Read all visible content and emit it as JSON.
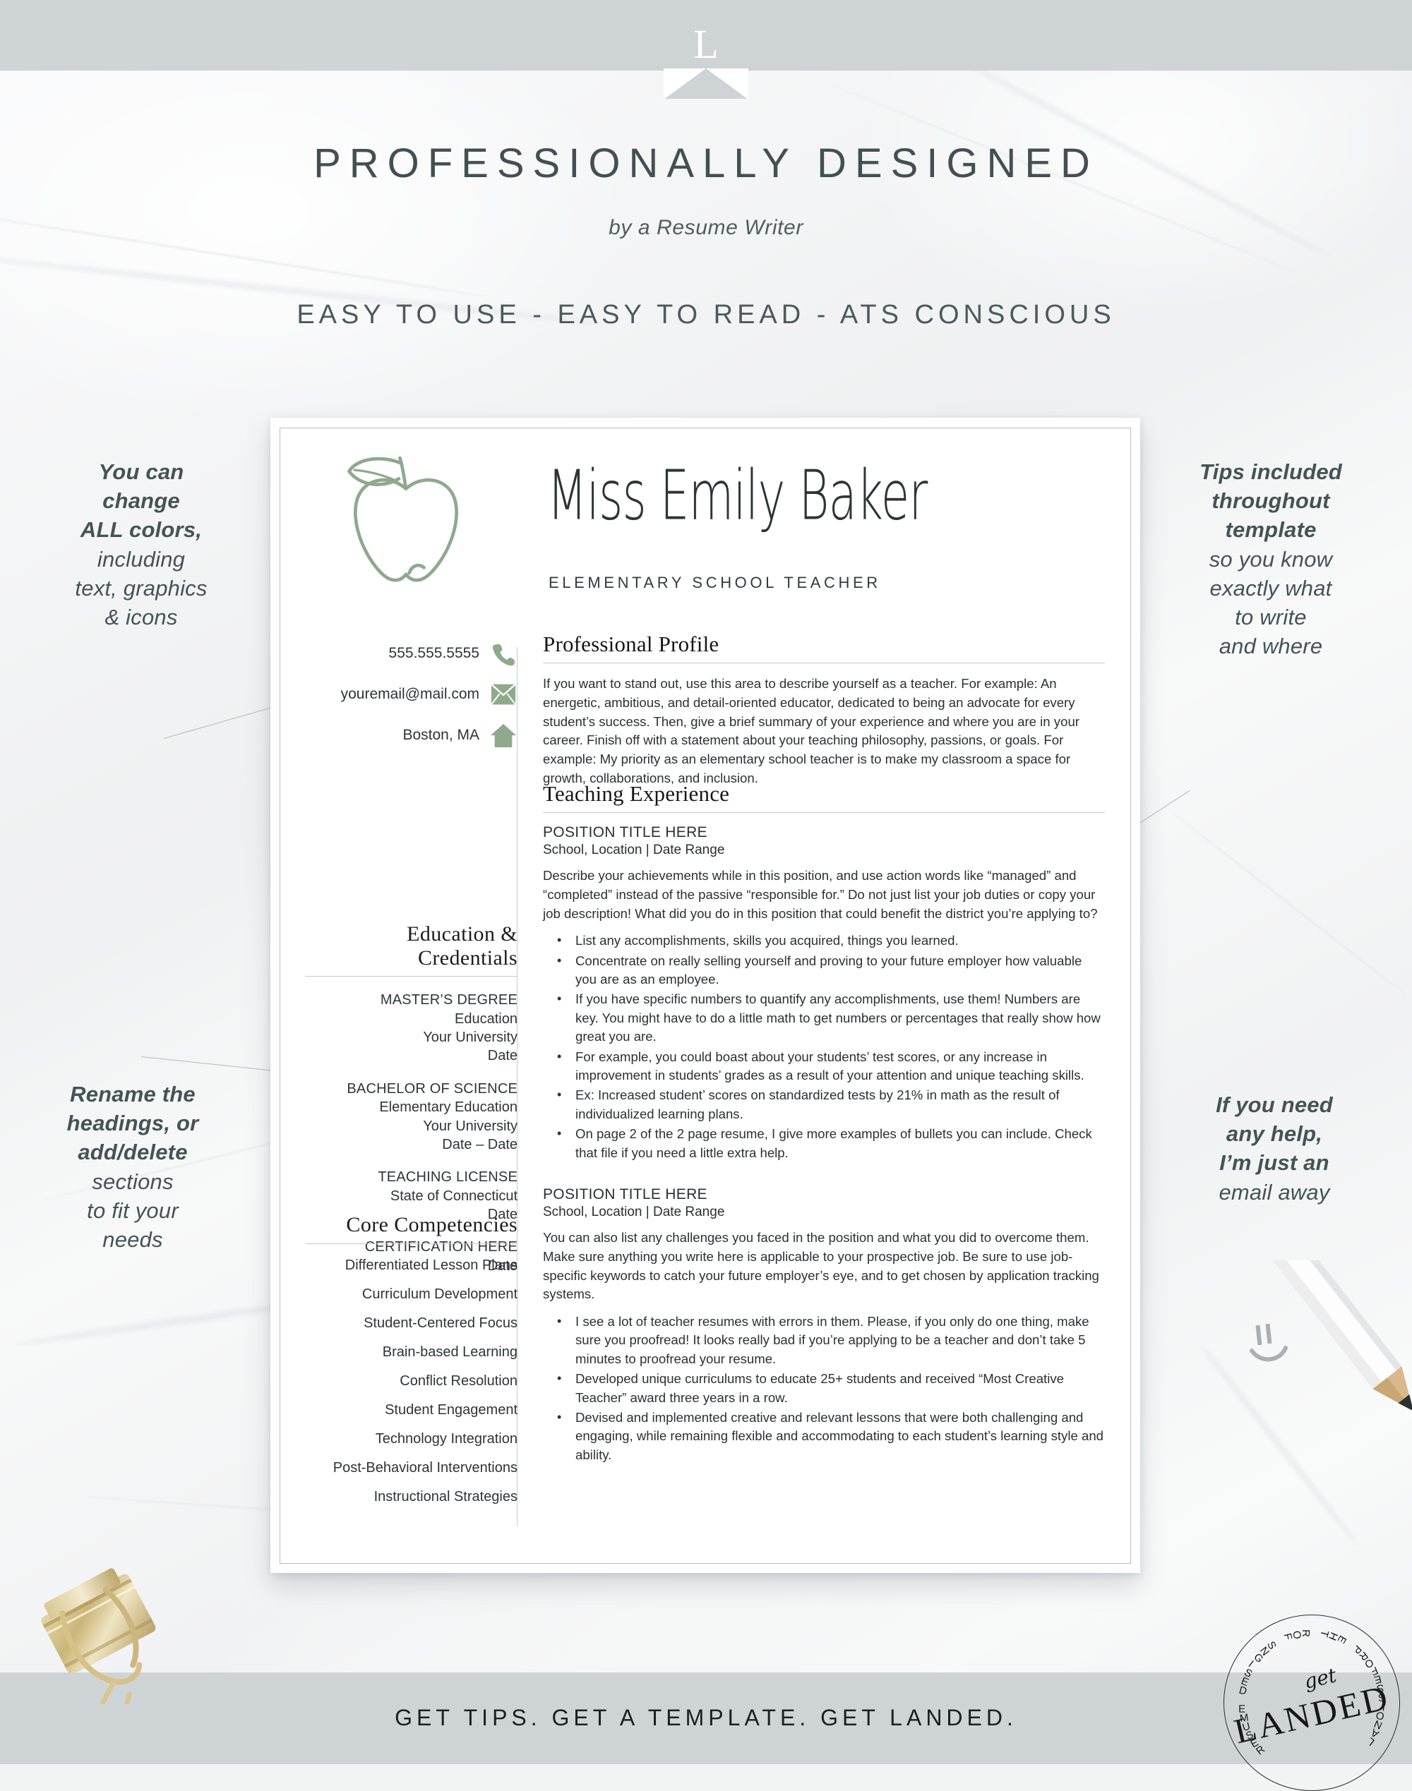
{
  "brand": {
    "ribbon_monogram": "L",
    "stamp_get": "get",
    "stamp_landed": "LANDED",
    "stamp_arc": "RESUME DESIGNS FOR THE PROFESSIONAL",
    "accent_green": "#8fa98d",
    "bar_gray": "#ced4d6",
    "ink": "#2f3436",
    "annotation_color": "#455355"
  },
  "header": {
    "title": "PROFESSIONALLY DESIGNED",
    "subtitle": "by a Resume Writer",
    "tagline": "EASY TO USE - EASY TO READ - ATS CONSCIOUS"
  },
  "footer": {
    "tagline": "GET TIPS. GET A TEMPLATE. GET LANDED."
  },
  "annotations": {
    "top_left": [
      "You can",
      "change",
      "ALL colors,",
      "including",
      "text, graphics",
      "& icons"
    ],
    "bottom_left": [
      "Rename the",
      "headings, or",
      "add/delete",
      "sections",
      "to fit your",
      "needs"
    ],
    "top_right": [
      "Tips included",
      "throughout",
      "template",
      "so you know",
      "exactly what",
      "to write",
      "and where"
    ],
    "bottom_right": [
      "If you need",
      "any help,",
      "I’m just an",
      "email away"
    ]
  },
  "resume": {
    "name": "Miss Emily Baker",
    "job_title": "ELEMENTARY SCHOOL TEACHER",
    "logo_icon": "apple-icon",
    "contacts": [
      {
        "value": "555.555.5555",
        "icon": "phone-icon"
      },
      {
        "value": "youremail@mail.com",
        "icon": "envelope-icon"
      },
      {
        "value": "Boston, MA",
        "icon": "home-icon"
      }
    ],
    "sidebar": {
      "education": {
        "heading_line1": "Education &",
        "heading_line2": "Credentials",
        "entries": [
          {
            "title": "MASTER’S DEGREE",
            "lines": [
              "Education",
              "Your University",
              "Date"
            ]
          },
          {
            "title": "BACHELOR OF SCIENCE",
            "lines": [
              "Elementary Education",
              "Your University",
              "Date – Date"
            ]
          },
          {
            "title": "TEACHING LICENSE",
            "lines": [
              "State of Connecticut",
              "Date"
            ]
          },
          {
            "title": "CERTIFICATION HERE",
            "lines": [
              "Date"
            ]
          }
        ]
      },
      "competencies": {
        "heading": "Core Competencies",
        "items": [
          "Differentiated Lesson Plans",
          "Curriculum Development",
          "Student-Centered Focus",
          "Brain-based Learning",
          "Conflict Resolution",
          "Student Engagement",
          "Technology Integration",
          "Post-Behavioral Interventions",
          "Instructional Strategies"
        ]
      }
    },
    "main": {
      "profile": {
        "heading": "Professional Profile",
        "body": "If you want to stand out, use this area to describe yourself as a teacher.  For example: An energetic, ambitious, and detail-oriented educator, dedicated to being an advocate for every student’s success.  Then, give a brief summary of your experience and where you are in your career.   Finish off with a statement about your teaching philosophy, passions, or goals.  For example: My priority as an elementary school teacher is to make my classroom a space for growth, collaborations, and inclusion."
      },
      "experience": {
        "heading": "Teaching Experience",
        "positions": [
          {
            "title": "POSITION TITLE HERE",
            "meta": "School, Location | Date Range",
            "body": "Describe your achievements while in this position, and use action words like “managed” and “completed” instead of the passive “responsible for.”  Do not just list your job duties or copy your job description!  What did you do in this position that could benefit the district you’re applying to?",
            "bullets": [
              "List any accomplishments, skills you acquired, things you learned.",
              "Concentrate on really selling yourself and proving to your future employer how valuable you are as an employee.",
              "If you have specific numbers to quantify any accomplishments, use them!  Numbers are key.  You might have to do a little math to get numbers or percentages that really show how great you are.",
              "For example, you could boast about your students’ test scores, or any increase in improvement in students’ grades as a result of your attention and unique teaching skills.",
              "Ex: Increased student’ scores on standardized tests by 21% in math as the result of individualized learning plans.",
              "On page 2 of the 2 page resume, I give more examples of bullets you can include.  Check that file if you need a little extra help."
            ]
          },
          {
            "title": "POSITION TITLE HERE",
            "meta": "School, Location | Date Range",
            "body": "You can also list any challenges you faced in the position and what you did to overcome them.  Make sure anything you write here is applicable to your prospective job.  Be sure to use job-specific keywords to catch your future employer’s eye, and to get chosen by application tracking systems.",
            "bullets": [
              "I see a lot of teacher resumes with errors in them.  Please, if you only do one thing, make sure you proofread!  It looks really bad if you’re applying to be a teacher and don’t take 5 minutes to proofread your resume.",
              "Developed unique curriculums to educate 25+ students and received “Most Creative Teacher” award three years in a row.",
              "Devised and implemented creative and relevant lessons that were both challenging and engaging, while remaining flexible and accommodating to each student’s learning style and ability."
            ]
          }
        ]
      }
    }
  }
}
